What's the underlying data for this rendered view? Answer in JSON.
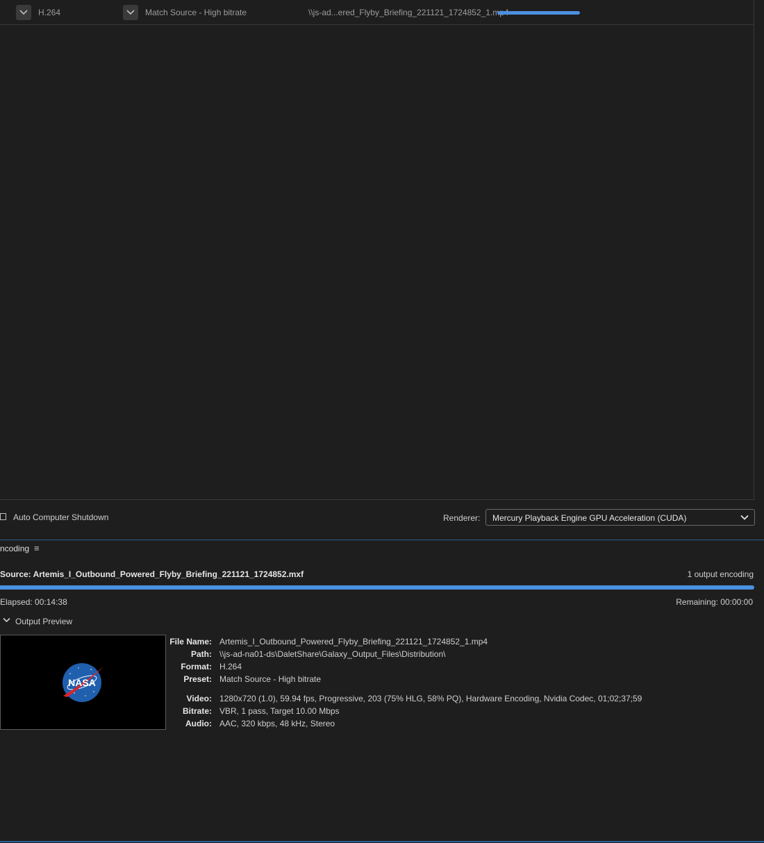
{
  "queue": {
    "row": {
      "format": "H.264",
      "preset": "Match Source - High bitrate",
      "output_file": "\\\\js-ad...ered_Flyby_Briefing_221121_1724852_1.mp4",
      "progress": 1.0
    }
  },
  "controls": {
    "auto_shutdown_label": "Auto Computer Shutdown",
    "auto_shutdown_checked": false,
    "renderer_label": "Renderer:",
    "renderer_value": "Mercury Playback Engine GPU Acceleration (CUDA)"
  },
  "encoding": {
    "tab_label": "ncoding",
    "source": "Source: Artemis_I_Outbound_Powered_Flyby_Briefing_221121_1724852.mxf",
    "output_count": "1 output encoding",
    "progress": 1.0,
    "elapsed": "Elapsed: 00:14:38",
    "remaining": "Remaining: 00:00:00",
    "output_preview_label": "Output Preview",
    "preview_logo_text": "NASA",
    "details": {
      "file_name_label": "File Name:",
      "file_name": "Artemis_I_Outbound_Powered_Flyby_Briefing_221121_1724852_1.mp4",
      "path_label": "Path:",
      "path": "\\\\js-ad-na01-ds\\DaletShare\\Galaxy_Output_Files\\Distribution\\",
      "format_label": "Format:",
      "format": "H.264",
      "preset_label": "Preset:",
      "preset": "Match Source - High bitrate",
      "video_label": "Video:",
      "video": "1280x720 (1.0), 59.94 fps, Progressive, 203 (75% HLG, 58% PQ), Hardware Encoding, Nvidia Codec, 01;02;37;59",
      "bitrate_label": "Bitrate:",
      "bitrate": "VBR, 1 pass, Target 10.00 Mbps",
      "audio_label": "Audio:",
      "audio": "AAC, 320 kbps, 48 kHz, Stereo"
    }
  },
  "colors": {
    "accent": "#4a90e2",
    "background": "#1e1e1e"
  }
}
